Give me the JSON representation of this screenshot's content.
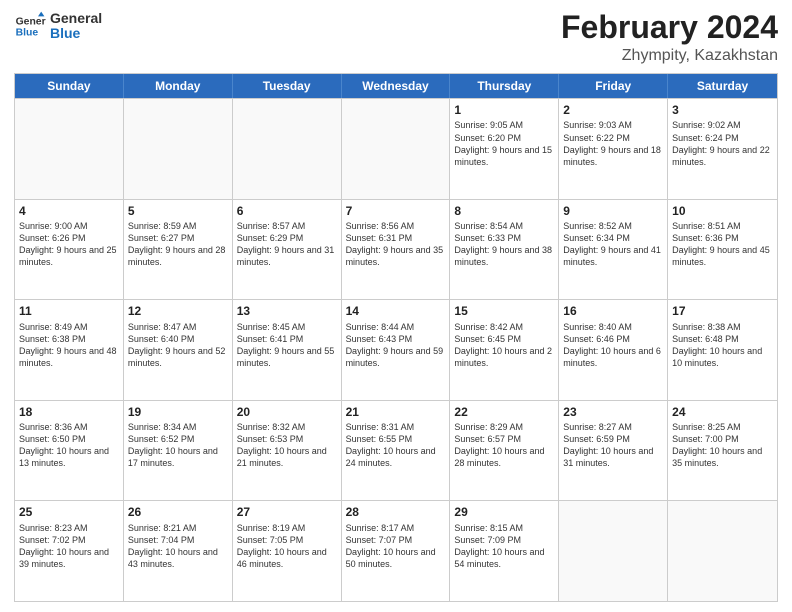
{
  "header": {
    "logo_general": "General",
    "logo_blue": "Blue",
    "month_title": "February 2024",
    "location": "Zhympity, Kazakhstan"
  },
  "days_of_week": [
    "Sunday",
    "Monday",
    "Tuesday",
    "Wednesday",
    "Thursday",
    "Friday",
    "Saturday"
  ],
  "weeks": [
    [
      {
        "day": "",
        "empty": true
      },
      {
        "day": "",
        "empty": true
      },
      {
        "day": "",
        "empty": true
      },
      {
        "day": "",
        "empty": true
      },
      {
        "day": "1",
        "sun": "Sunrise: 9:05 AM",
        "set": "Sunset: 6:20 PM",
        "day_len": "Daylight: 9 hours and 15 minutes."
      },
      {
        "day": "2",
        "sun": "Sunrise: 9:03 AM",
        "set": "Sunset: 6:22 PM",
        "day_len": "Daylight: 9 hours and 18 minutes."
      },
      {
        "day": "3",
        "sun": "Sunrise: 9:02 AM",
        "set": "Sunset: 6:24 PM",
        "day_len": "Daylight: 9 hours and 22 minutes."
      }
    ],
    [
      {
        "day": "4",
        "sun": "Sunrise: 9:00 AM",
        "set": "Sunset: 6:26 PM",
        "day_len": "Daylight: 9 hours and 25 minutes."
      },
      {
        "day": "5",
        "sun": "Sunrise: 8:59 AM",
        "set": "Sunset: 6:27 PM",
        "day_len": "Daylight: 9 hours and 28 minutes."
      },
      {
        "day": "6",
        "sun": "Sunrise: 8:57 AM",
        "set": "Sunset: 6:29 PM",
        "day_len": "Daylight: 9 hours and 31 minutes."
      },
      {
        "day": "7",
        "sun": "Sunrise: 8:56 AM",
        "set": "Sunset: 6:31 PM",
        "day_len": "Daylight: 9 hours and 35 minutes."
      },
      {
        "day": "8",
        "sun": "Sunrise: 8:54 AM",
        "set": "Sunset: 6:33 PM",
        "day_len": "Daylight: 9 hours and 38 minutes."
      },
      {
        "day": "9",
        "sun": "Sunrise: 8:52 AM",
        "set": "Sunset: 6:34 PM",
        "day_len": "Daylight: 9 hours and 41 minutes."
      },
      {
        "day": "10",
        "sun": "Sunrise: 8:51 AM",
        "set": "Sunset: 6:36 PM",
        "day_len": "Daylight: 9 hours and 45 minutes."
      }
    ],
    [
      {
        "day": "11",
        "sun": "Sunrise: 8:49 AM",
        "set": "Sunset: 6:38 PM",
        "day_len": "Daylight: 9 hours and 48 minutes."
      },
      {
        "day": "12",
        "sun": "Sunrise: 8:47 AM",
        "set": "Sunset: 6:40 PM",
        "day_len": "Daylight: 9 hours and 52 minutes."
      },
      {
        "day": "13",
        "sun": "Sunrise: 8:45 AM",
        "set": "Sunset: 6:41 PM",
        "day_len": "Daylight: 9 hours and 55 minutes."
      },
      {
        "day": "14",
        "sun": "Sunrise: 8:44 AM",
        "set": "Sunset: 6:43 PM",
        "day_len": "Daylight: 9 hours and 59 minutes."
      },
      {
        "day": "15",
        "sun": "Sunrise: 8:42 AM",
        "set": "Sunset: 6:45 PM",
        "day_len": "Daylight: 10 hours and 2 minutes."
      },
      {
        "day": "16",
        "sun": "Sunrise: 8:40 AM",
        "set": "Sunset: 6:46 PM",
        "day_len": "Daylight: 10 hours and 6 minutes."
      },
      {
        "day": "17",
        "sun": "Sunrise: 8:38 AM",
        "set": "Sunset: 6:48 PM",
        "day_len": "Daylight: 10 hours and 10 minutes."
      }
    ],
    [
      {
        "day": "18",
        "sun": "Sunrise: 8:36 AM",
        "set": "Sunset: 6:50 PM",
        "day_len": "Daylight: 10 hours and 13 minutes."
      },
      {
        "day": "19",
        "sun": "Sunrise: 8:34 AM",
        "set": "Sunset: 6:52 PM",
        "day_len": "Daylight: 10 hours and 17 minutes."
      },
      {
        "day": "20",
        "sun": "Sunrise: 8:32 AM",
        "set": "Sunset: 6:53 PM",
        "day_len": "Daylight: 10 hours and 21 minutes."
      },
      {
        "day": "21",
        "sun": "Sunrise: 8:31 AM",
        "set": "Sunset: 6:55 PM",
        "day_len": "Daylight: 10 hours and 24 minutes."
      },
      {
        "day": "22",
        "sun": "Sunrise: 8:29 AM",
        "set": "Sunset: 6:57 PM",
        "day_len": "Daylight: 10 hours and 28 minutes."
      },
      {
        "day": "23",
        "sun": "Sunrise: 8:27 AM",
        "set": "Sunset: 6:59 PM",
        "day_len": "Daylight: 10 hours and 31 minutes."
      },
      {
        "day": "24",
        "sun": "Sunrise: 8:25 AM",
        "set": "Sunset: 7:00 PM",
        "day_len": "Daylight: 10 hours and 35 minutes."
      }
    ],
    [
      {
        "day": "25",
        "sun": "Sunrise: 8:23 AM",
        "set": "Sunset: 7:02 PM",
        "day_len": "Daylight: 10 hours and 39 minutes."
      },
      {
        "day": "26",
        "sun": "Sunrise: 8:21 AM",
        "set": "Sunset: 7:04 PM",
        "day_len": "Daylight: 10 hours and 43 minutes."
      },
      {
        "day": "27",
        "sun": "Sunrise: 8:19 AM",
        "set": "Sunset: 7:05 PM",
        "day_len": "Daylight: 10 hours and 46 minutes."
      },
      {
        "day": "28",
        "sun": "Sunrise: 8:17 AM",
        "set": "Sunset: 7:07 PM",
        "day_len": "Daylight: 10 hours and 50 minutes."
      },
      {
        "day": "29",
        "sun": "Sunrise: 8:15 AM",
        "set": "Sunset: 7:09 PM",
        "day_len": "Daylight: 10 hours and 54 minutes."
      },
      {
        "day": "",
        "empty": true
      },
      {
        "day": "",
        "empty": true
      }
    ]
  ]
}
